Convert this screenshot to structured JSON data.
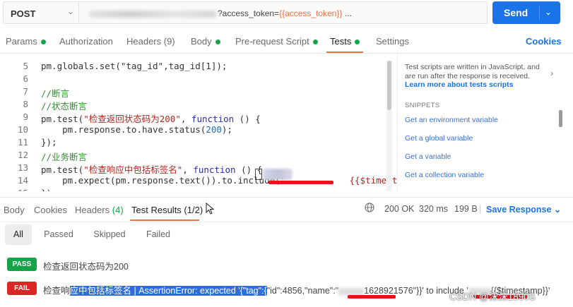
{
  "request": {
    "method": "POST",
    "url_suffix": "?access_token=",
    "url_var": "{{access_token}}",
    "url_tail": " ...",
    "send_label": "Send"
  },
  "req_tabs": [
    {
      "label": "Params"
    },
    {
      "label": "Authorization"
    },
    {
      "label": "Headers (9)"
    },
    {
      "label": "Body"
    },
    {
      "label": "Pre-request Script"
    },
    {
      "label": "Tests"
    },
    {
      "label": "Settings"
    }
  ],
  "cookies_label": "Cookies",
  "code": {
    "l5": {
      "num": "5",
      "text": "pm.globals.set(\"tag_id\",tag_id[1]);"
    },
    "l6": {
      "num": "6"
    },
    "l7": {
      "num": "7",
      "text": "//断言"
    },
    "l8": {
      "num": "8",
      "text": "//状态断言"
    },
    "l9": {
      "num": "9",
      "a": "pm.test(",
      "s": "\"检查返回状态码为200\"",
      "b": ", ",
      "k": "function",
      "c": " () {"
    },
    "l10": {
      "num": "10",
      "a": "    pm.response.to.have.status(",
      "n": "200",
      "c": ");"
    },
    "l11": {
      "num": "11",
      "text": "});"
    },
    "l12": {
      "num": "12",
      "text": "//业务断言"
    },
    "l13": {
      "num": "13",
      "a": "pm.test(",
      "s": "\"检查响应中包括标签名\"",
      "b": ", ",
      "k": "function",
      "c": " () {"
    },
    "l14": {
      "num": "14",
      "a": "    pm.expect(pm.response.text()).to.include(",
      "s": "\"            {{$timestamp}}\"",
      "c": ");"
    },
    "l15": {
      "num": "15",
      "text": "});"
    }
  },
  "right_panel": {
    "info": "Test scripts are written in JavaScript, and are run after the response is received.",
    "link": "Learn more about tests scripts",
    "snippets_heading": "SNIPPETS",
    "snippets": [
      "Get an environment variable",
      "Get a global variable",
      "Get a variable",
      "Get a collection variable"
    ]
  },
  "response": {
    "tabs": [
      "Body",
      "Cookies",
      "Headers",
      "Test Results (1/2)"
    ],
    "headers_count": "(4)",
    "status": "200 OK",
    "time": "320 ms",
    "size": "199 B",
    "save_label": "Save Response"
  },
  "filters": [
    "All",
    "Passed",
    "Skipped",
    "Failed"
  ],
  "results": [
    {
      "status": "PASS",
      "text": "检查返回状态码为200"
    },
    {
      "status": "FAIL",
      "pre": "检查响",
      "sel": "应中包括标签名 | AssertionError: expected '{\"tag\":{",
      "mid": "\"id\":4856,\"name\":\"",
      "tail": "1628921576\"}}' to include '",
      "tail2": "{{$timestamp}}'"
    }
  ],
  "watermark": "CSDN @沫沫1890S",
  "colors": {
    "accent_blue": "#1a73e8",
    "pass_green": "#16a34a",
    "fail_red": "#dc2626",
    "tab_orange": "#e8744a"
  }
}
